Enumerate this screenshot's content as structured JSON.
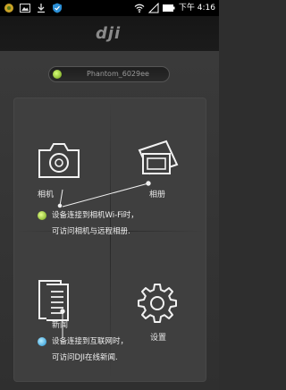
{
  "status_bar": {
    "time": "下午 4:16",
    "icons": [
      "notification-icon",
      "image-icon",
      "download-icon",
      "shield-icon",
      "wifi-icon",
      "signal-icon",
      "battery-icon"
    ]
  },
  "header": {
    "logo_text": "dji"
  },
  "device": {
    "name": "Phantom_6029ee",
    "status_color": "#8bc327"
  },
  "tiles": {
    "camera": {
      "label": "相机",
      "icon": "camera-icon"
    },
    "album": {
      "label": "相册",
      "icon": "photo-album-icon"
    },
    "news": {
      "label": "新闻",
      "icon": "news-document-icon"
    },
    "settings": {
      "label": "设置",
      "icon": "gear-icon"
    }
  },
  "tips": {
    "camera_wifi": {
      "line1": "设备连接到相机Wi-Fi时，",
      "line2": "可访问相机与远程相册.",
      "color": "#9acd32"
    },
    "internet": {
      "line1": "设备连接到互联网时，",
      "line2": "可访问DJI在线新闻.",
      "color": "#29a7e1"
    }
  }
}
